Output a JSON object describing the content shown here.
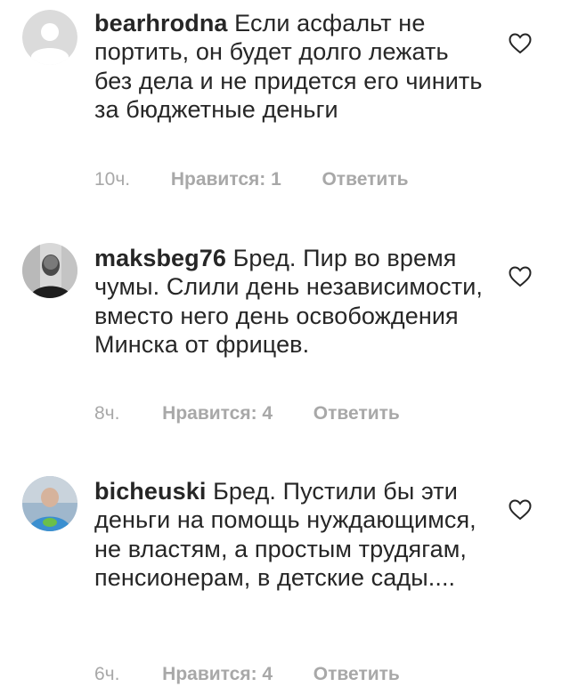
{
  "comments": [
    {
      "username": "bearhrodna",
      "text": "Если асфальт не портить, он будет долго лежать без дела и не придется его чинить за бюджетные деньги",
      "time": "10ч.",
      "likes": "Нравится: 1",
      "reply": "Ответить",
      "avatar_icon": "default-avatar-icon"
    },
    {
      "username": "maksbeg76",
      "text": "Бред. Пир во время чумы. Слили день независимости, вместо него день освобождения Минска от фрицев.",
      "time": "8ч.",
      "likes": "Нравится: 4",
      "reply": "Ответить",
      "avatar_icon": "user-photo"
    },
    {
      "username": "bicheuski",
      "text": "Бред. Пустили бы эти деньги на помощь нуждающимся, не властям, а простым трудягам, пенсионерам, в детские сады....",
      "time": "6ч.",
      "likes": "Нравится: 4",
      "reply": "Ответить",
      "avatar_icon": "user-photo"
    }
  ],
  "colors": {
    "text": "#262626",
    "meta": "#a8a8a8",
    "default_avatar_bg": "#dbdbdb"
  },
  "icons": {
    "like": "heart-icon"
  }
}
